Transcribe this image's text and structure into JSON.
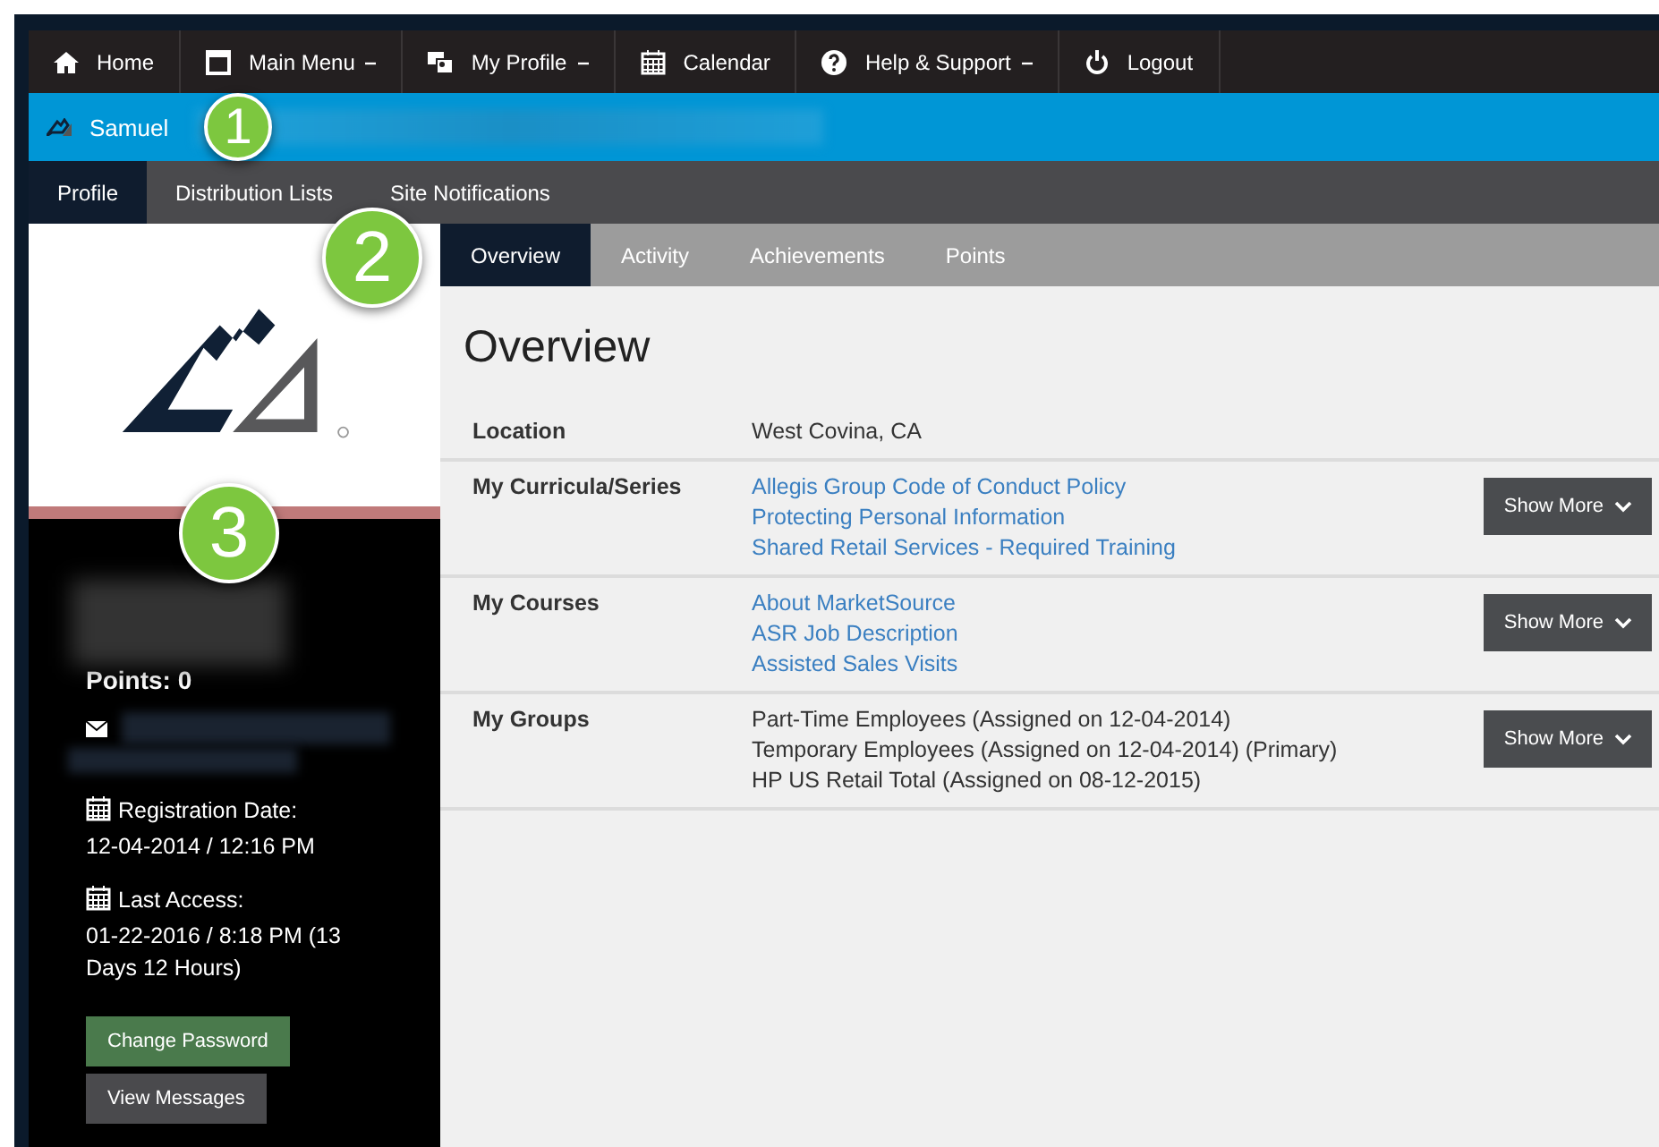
{
  "top_nav": [
    {
      "label": "Home",
      "dropdown": false
    },
    {
      "label": "Main Menu",
      "dropdown": true
    },
    {
      "label": "My Profile",
      "dropdown": true
    },
    {
      "label": "Calendar",
      "dropdown": false
    },
    {
      "label": "Help & Support",
      "dropdown": true
    },
    {
      "label": "Logout",
      "dropdown": false
    }
  ],
  "user_bar": {
    "name": "Samuel"
  },
  "profile_tabs": [
    {
      "label": "Profile",
      "selected": true
    },
    {
      "label": "Distribution Lists",
      "selected": false
    },
    {
      "label": "Site Notifications",
      "selected": false
    }
  ],
  "sidebar": {
    "points": "Points: 0",
    "registration_label": "Registration Date:",
    "registration_value": "12-04-2014 / 12:16 PM",
    "last_access_label": "Last Access:",
    "last_access_value": "01-22-2016 / 8:18 PM  (13 Days 12 Hours)",
    "buttons": [
      {
        "label": "Change Password",
        "kind": "primary"
      },
      {
        "label": "View Messages",
        "kind": "secondary"
      }
    ]
  },
  "section_tabs": [
    {
      "label": "Overview",
      "selected": true
    },
    {
      "label": "Activity",
      "selected": false
    },
    {
      "label": "Achievements",
      "selected": false
    },
    {
      "label": "Points",
      "selected": false
    }
  ],
  "overview": {
    "title": "Overview",
    "rows": [
      {
        "label": "Location",
        "kind": "text",
        "items": [
          "West Covina, CA"
        ]
      },
      {
        "label": "My Curricula/Series",
        "kind": "links",
        "items": [
          "Allegis Group Code of Conduct Policy",
          "Protecting Personal Information",
          "Shared Retail Services - Required Training"
        ],
        "button": "Show More"
      },
      {
        "label": "My Courses",
        "kind": "links",
        "items": [
          "About MarketSource",
          "ASR Job Description",
          "Assisted Sales Visits"
        ],
        "button": "Show More"
      },
      {
        "label": "My Groups",
        "kind": "text",
        "items": [
          "Part-Time Employees (Assigned on 12-04-2014)",
          "Temporary Employees (Assigned on 12-04-2014) (Primary)",
          "HP US Retail Total (Assigned on 08-12-2015)"
        ],
        "button": "Show More"
      }
    ]
  },
  "callouts": [
    "1",
    "2",
    "3"
  ]
}
